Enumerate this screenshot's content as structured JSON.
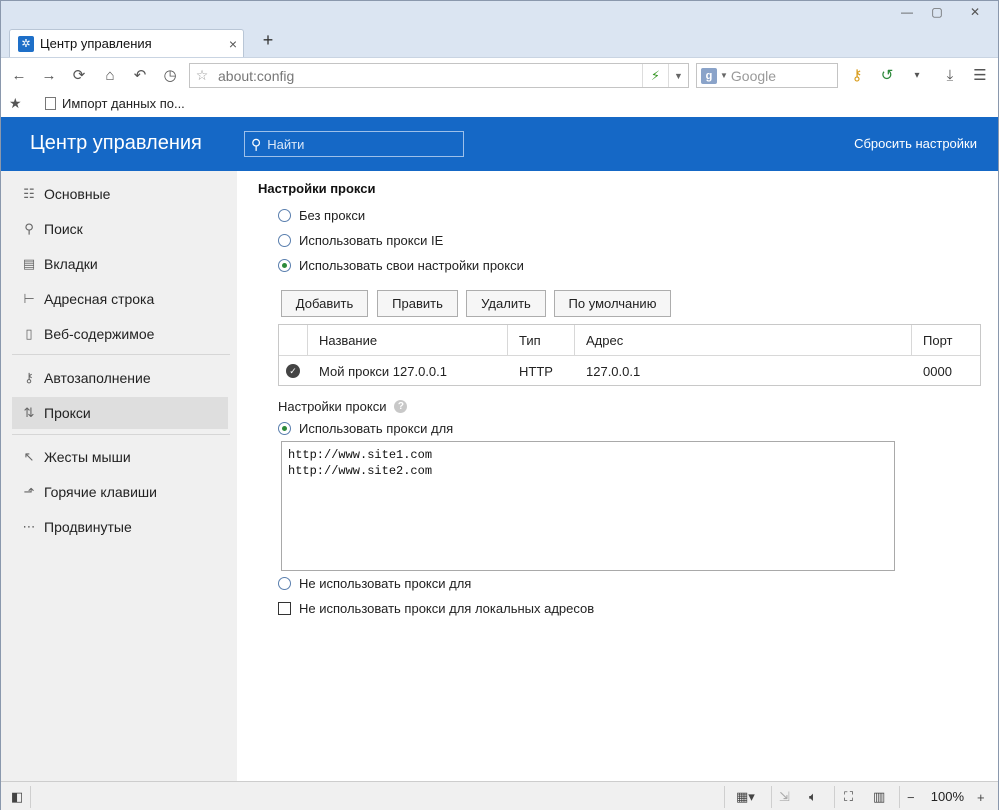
{
  "tab": {
    "title": "Центр управления",
    "close": "×",
    "new": "+"
  },
  "window": {
    "minimize": "—",
    "maximize": "▢",
    "close": "✕"
  },
  "nav": {
    "url": "about:config",
    "search_placeholder": "Google"
  },
  "bookmarks": {
    "item": "Импорт данных по..."
  },
  "header": {
    "title": "Центр управления",
    "search_placeholder": "Найти",
    "reset": "Сбросить настройки"
  },
  "sidebar": {
    "items": [
      {
        "label": "Основные",
        "icon": "sliders-icon"
      },
      {
        "label": "Поиск",
        "icon": "search-icon"
      },
      {
        "label": "Вкладки",
        "icon": "tabs-icon"
      },
      {
        "label": "Адресная строка",
        "icon": "addressbar-icon"
      },
      {
        "label": "Веб-содержимое",
        "icon": "page-icon"
      },
      {
        "label": "Автозаполнение",
        "icon": "key-icon"
      },
      {
        "label": "Прокси",
        "icon": "proxy-icon"
      },
      {
        "label": "Жесты мыши",
        "icon": "cursor-icon"
      },
      {
        "label": "Горячие клавиши",
        "icon": "hotkey-icon"
      },
      {
        "label": "Продвинутые",
        "icon": "dots-icon"
      }
    ],
    "active": "Прокси"
  },
  "proxy": {
    "section_title": "Настройки прокси",
    "options": [
      {
        "label": "Без прокси",
        "selected": false
      },
      {
        "label": "Использовать прокси IE",
        "selected": false
      },
      {
        "label": "Использовать свои настройки прокси",
        "selected": true
      }
    ],
    "buttons": {
      "add": "Добавить",
      "edit": "Править",
      "delete": "Удалить",
      "default": "По умолчанию"
    },
    "table": {
      "headers": [
        "Название",
        "Тип",
        "Адрес",
        "Порт"
      ],
      "rows": [
        {
          "name": "Мой прокси 127.0.0.1",
          "type": "HTTP",
          "address": "127.0.0.1",
          "port": "0000"
        }
      ]
    },
    "sub_title": "Настройки прокси",
    "use_for_label": "Использовать прокси для",
    "use_for_list": "http://www.site1.com\nhttp://www.site2.com",
    "not_use_for_label": "Не использовать прокси для",
    "local_label": "Не использовать прокси для локальных адресов"
  },
  "status": {
    "zoom": "100%"
  }
}
